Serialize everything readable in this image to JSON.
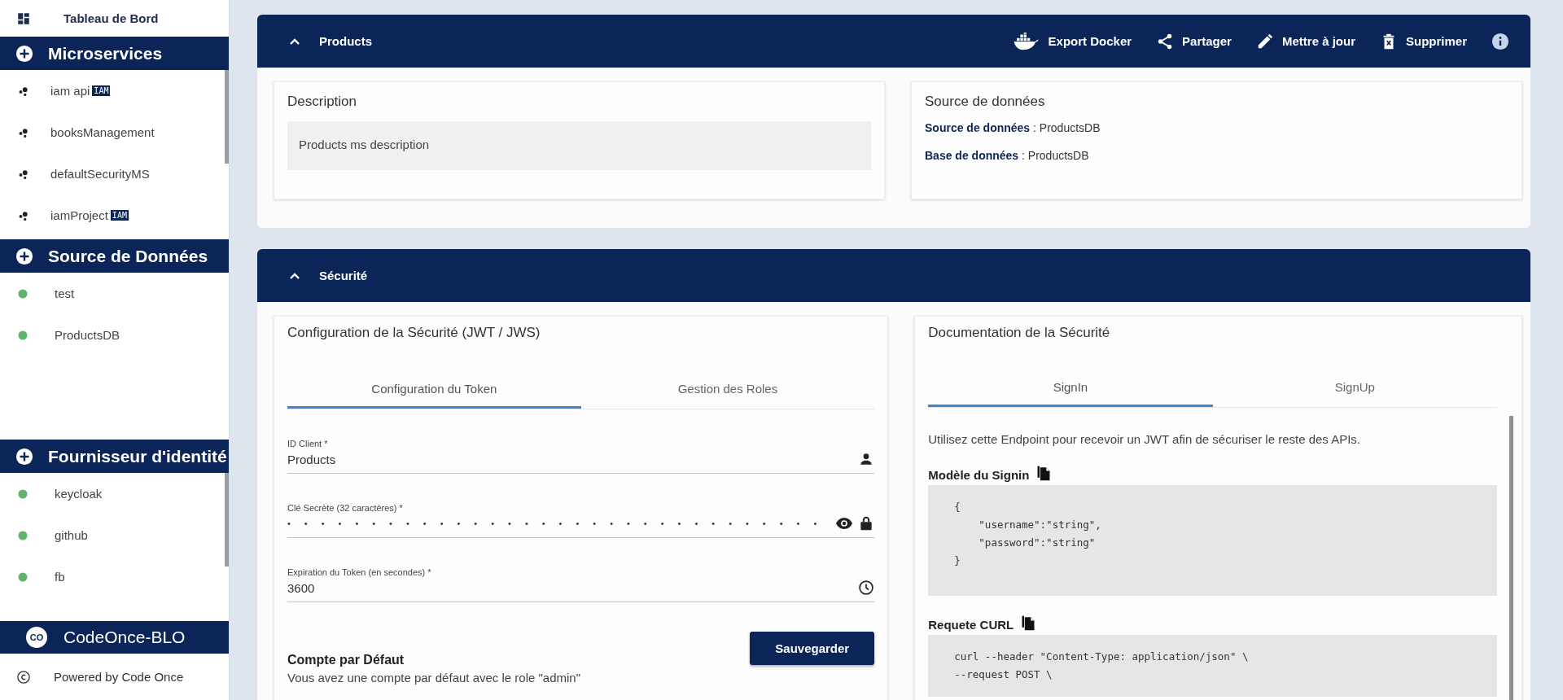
{
  "sidebar": {
    "dashboard": {
      "label": "Tableau de Bord"
    },
    "sections": [
      {
        "title": "Microservices",
        "kind": "microservice",
        "items": [
          {
            "label": "iam api",
            "badge": "IAM"
          },
          {
            "label": "booksManagement"
          },
          {
            "label": "defaultSecurityMS"
          },
          {
            "label": "iamProject",
            "badge": "IAM"
          }
        ]
      },
      {
        "title": "Source de Données",
        "kind": "datasource",
        "items": [
          {
            "label": "test"
          },
          {
            "label": "ProductsDB"
          }
        ]
      },
      {
        "title": "Fournisseur d'identité",
        "kind": "datasource",
        "items": [
          {
            "label": "keycloak"
          },
          {
            "label": "github"
          },
          {
            "label": "fb"
          }
        ]
      }
    ],
    "project": {
      "logo": "CO",
      "name": "CodeOnce-BLO"
    },
    "footer": "Powered by Code Once"
  },
  "products": {
    "title": "Products",
    "actions": [
      {
        "kind": "docker",
        "label": "Export Docker"
      },
      {
        "kind": "share",
        "label": "Partager"
      },
      {
        "kind": "edit",
        "label": "Mettre à jour"
      },
      {
        "kind": "delete",
        "label": "Supprimer"
      },
      {
        "kind": "info"
      }
    ],
    "description": {
      "title": "Description",
      "text": "Products ms description"
    },
    "datasource": {
      "title": "Source de données",
      "lines": [
        "**Source de données** : ProductsDB",
        "**Base de données** : ProductsDB"
      ]
    }
  },
  "security": {
    "title": "Sécurité",
    "config": {
      "title": "Configuration de la Sécurité (JWT / JWS)",
      "tabs": [
        {
          "label": "Configuration du Token",
          "selected": true
        },
        {
          "label": "Gestion des Roles",
          "selected": false
        }
      ],
      "fields": [
        {
          "kind": "user",
          "label": "ID Client *",
          "value": "Products"
        },
        {
          "kind": "password",
          "label": "Clé Secrète (32 caractères) *",
          "value": "••••••••••••••••••••••••••••••••"
        },
        {
          "kind": "clock",
          "label": "Expiration du Token (en secondes) *",
          "value": "3600"
        }
      ],
      "save": "Sauvegarder",
      "account": {
        "title": "Compte par Défaut",
        "text": "Vous avez une compte par défaut avec le role \"admin\""
      }
    },
    "docs": {
      "title": "Documentation de la Sécurité",
      "tabs": [
        {
          "label": "SignIn",
          "selected": true
        },
        {
          "label": "SignUp",
          "selected": false
        }
      ],
      "intro": "Utilisez cette Endpoint pour recevoir un JWT afin de sécuriser le reste des APIs.",
      "blocks": [
        {
          "title": "Modèle du Signin",
          "lines": [
            "{",
            "    \"username\":\"string\",",
            "    \"password\":\"string\"",
            "}"
          ]
        },
        {
          "title": "Requete CURL",
          "lines": [
            "curl --header \"Content-Type: application/json\" \\",
            "--request POST \\"
          ]
        }
      ]
    }
  }
}
